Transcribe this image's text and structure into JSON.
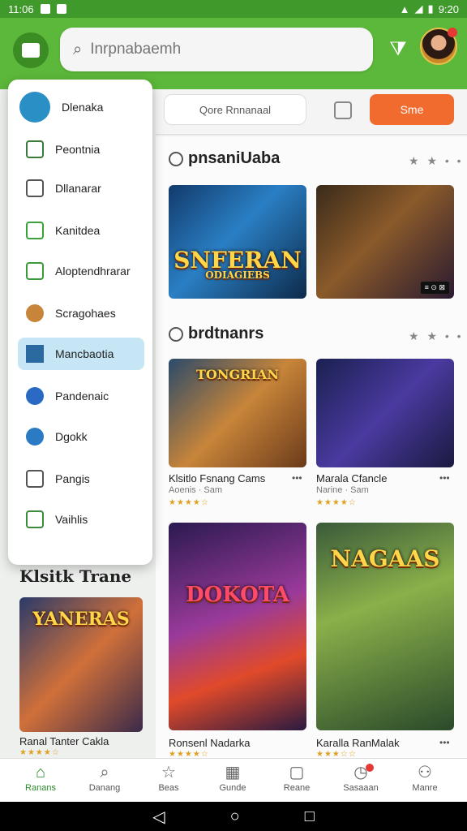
{
  "status": {
    "time": "11:06",
    "right_time": "9:20"
  },
  "search": {
    "placeholder": "Inrpnabaemh"
  },
  "topbar": {
    "pill_label": "Qore Rnnanaal",
    "orange_label": "Sme"
  },
  "drawer": {
    "items": [
      {
        "label": "Dlenaka",
        "icon": "home-icon",
        "color": "#2a8fc4"
      },
      {
        "label": "Peontnia",
        "icon": "list-icon",
        "color": "#3a7a3a"
      },
      {
        "label": "Dllanarar",
        "icon": "chat-icon",
        "color": "#555555"
      },
      {
        "label": "Kanitdea",
        "icon": "search-icon",
        "color": "#3aa03a"
      },
      {
        "label": "Aloptendhrarar",
        "icon": "leaf-icon",
        "color": "#3a9a3a"
      },
      {
        "label": "Scragohaes",
        "icon": "avatar-icon",
        "color": "#c8853a"
      },
      {
        "label": "Mancbaotia",
        "icon": "game-icon",
        "color": "#2a6aa0"
      },
      {
        "label": "Pandenaic",
        "icon": "controller-icon",
        "color": "#2a6ac4"
      },
      {
        "label": "Dgokk",
        "icon": "sword-icon",
        "color": "#2a7ac4"
      },
      {
        "label": "Pangis",
        "icon": "bag-icon",
        "color": "#555555"
      },
      {
        "label": "Vaihlis",
        "icon": "box-icon",
        "color": "#3a8a3a"
      }
    ],
    "active_index": 6
  },
  "sections": [
    {
      "title": "pnsaniUaba",
      "more": "★ ★ • •"
    },
    {
      "title": "brdtnanrs",
      "more": "★ ★ • •"
    }
  ],
  "tiles": {
    "t1_text": "SNFERAN",
    "t1_sub": "ODIAGIEBS",
    "t2_tag": "≡ ⊙ ⊠",
    "t3_text": "TONGRIAN",
    "t5_text": "DOKOTA",
    "t6_text": "NAGAAS",
    "t7_text": "YANERAS"
  },
  "cards": [
    {
      "title": "Klsitlo Fsnang Cams",
      "sub": "Aoenis · Sam",
      "stars": "★★★★☆"
    },
    {
      "title": "Marala Cfancle",
      "sub": "Narine · Sam",
      "stars": "★★★★☆"
    },
    {
      "title": "Ronsenl Nadarka",
      "sub": "",
      "stars": "★★★★☆"
    },
    {
      "title": "Karalla RanMalak",
      "sub": "",
      "stars": "★★★☆☆"
    },
    {
      "title": "Ranal Tanter Cakla",
      "sub": "",
      "stars": "★★★★☆"
    }
  ],
  "left_section": {
    "title": "Klsitk Trane"
  },
  "bottom_nav": [
    {
      "label": "Ranans",
      "icon": "home-icon"
    },
    {
      "label": "Danang",
      "icon": "search-icon"
    },
    {
      "label": "Beas",
      "icon": "star-icon"
    },
    {
      "label": "Gunde",
      "icon": "calendar-icon"
    },
    {
      "label": "Reane",
      "icon": "clipboard-icon"
    },
    {
      "label": "Sasaaan",
      "icon": "clock-icon"
    },
    {
      "label": "Manre",
      "icon": "person-icon"
    }
  ],
  "bottom_nav_active": 0
}
